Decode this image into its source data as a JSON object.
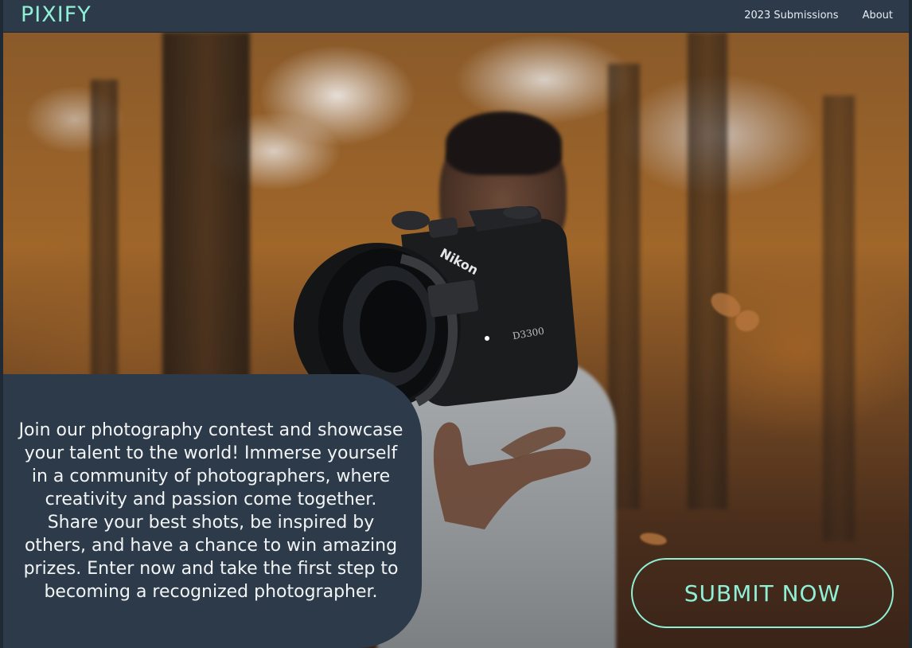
{
  "header": {
    "brand": "PIXIFY",
    "nav": [
      {
        "label": "2023 Submissions"
      },
      {
        "label": "About"
      }
    ]
  },
  "hero": {
    "description": "Join our photography contest and showcase your talent to the world! Immerse yourself in a community of photographers, where creativity and passion come together. Share your best shots, be inspired by others, and have a chance to win amazing prizes. Enter now and take the first step to becoming a recognized photographer.",
    "cta_label": "SUBMIT NOW",
    "camera_brand": "Nikon",
    "camera_model": "D3300"
  },
  "colors": {
    "accent": "#8ff0d6",
    "nav_background": "#2c3a49",
    "panel_background": "#2c3a49",
    "text_light": "#f2f4f6"
  }
}
